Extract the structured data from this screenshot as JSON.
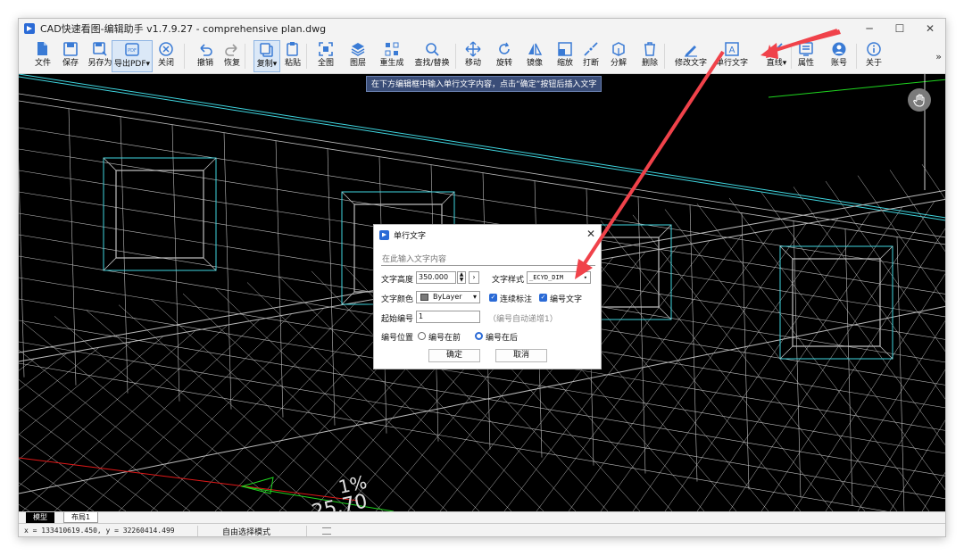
{
  "window": {
    "title": "CAD快速看图-编辑助手 v1.7.9.27 - comprehensive plan.dwg"
  },
  "toolbar": {
    "items": [
      {
        "label": "文件",
        "icon": "file-icon"
      },
      {
        "label": "保存",
        "icon": "save-icon"
      },
      {
        "label": "另存为",
        "icon": "save-as-icon"
      },
      {
        "label": "导出PDF▾",
        "icon": "export-pdf-icon"
      },
      {
        "label": "关闭",
        "icon": "close-circle-icon"
      },
      {
        "label": "撤销",
        "icon": "undo-icon"
      },
      {
        "label": "恢复",
        "icon": "redo-icon"
      },
      {
        "label": "复制▾",
        "icon": "copy-icon"
      },
      {
        "label": "粘贴",
        "icon": "paste-icon"
      },
      {
        "label": "全图",
        "icon": "zoom-extents-icon"
      },
      {
        "label": "图层",
        "icon": "layers-icon"
      },
      {
        "label": "重生成",
        "icon": "regen-icon"
      },
      {
        "label": "查找/替换",
        "icon": "find-replace-icon"
      },
      {
        "label": "移动",
        "icon": "move-icon"
      },
      {
        "label": "旋转",
        "icon": "rotate-icon"
      },
      {
        "label": "镜像",
        "icon": "mirror-icon"
      },
      {
        "label": "缩放",
        "icon": "scale-icon"
      },
      {
        "label": "打断",
        "icon": "break-icon"
      },
      {
        "label": "分解",
        "icon": "explode-icon"
      },
      {
        "label": "删除",
        "icon": "delete-icon"
      },
      {
        "label": "修改文字",
        "icon": "edit-text-icon"
      },
      {
        "label": "单行文字",
        "icon": "single-line-text-icon"
      },
      {
        "label": "直线▾",
        "icon": "line-icon"
      },
      {
        "label": "属性",
        "icon": "properties-icon"
      },
      {
        "label": "账号",
        "icon": "account-icon"
      },
      {
        "label": "关于",
        "icon": "about-icon"
      }
    ],
    "more": "»"
  },
  "tooltip": "在下方编辑框中输入单行文字内容，点击“确定”按钮后插入文字",
  "canvas_text": {
    "t1": "1%",
    "t2": "25.70"
  },
  "dialog": {
    "title": "单行文字",
    "close": "✕",
    "placeholder": "在此输入文字内容",
    "height_label": "文字高度",
    "height_value": "350.000",
    "style_label": "文字样式",
    "style_value": "_ECYD_DIM",
    "color_label": "文字颜色",
    "color_value": "ByLayer",
    "continuous_label": "连续标注",
    "numbered_label": "编号文字",
    "start_label": "起始编号",
    "start_value": "1",
    "start_hint": "（编号自动递增1）",
    "position_label": "编号位置",
    "pos_before": "编号在前",
    "pos_after": "编号在后",
    "ok": "确定",
    "cancel": "取消"
  },
  "tabs": {
    "model": "模型",
    "layout": "布局1"
  },
  "status": {
    "coords": "x = 133410619.450, y = 32260414.499",
    "mode": "自由选择模式"
  },
  "colors": {
    "accent": "#2a6ad6",
    "arrow": "#f0424a",
    "cyan_line": "#3fd6e0",
    "green_line": "#1fd61f",
    "red_line": "#e01818"
  }
}
